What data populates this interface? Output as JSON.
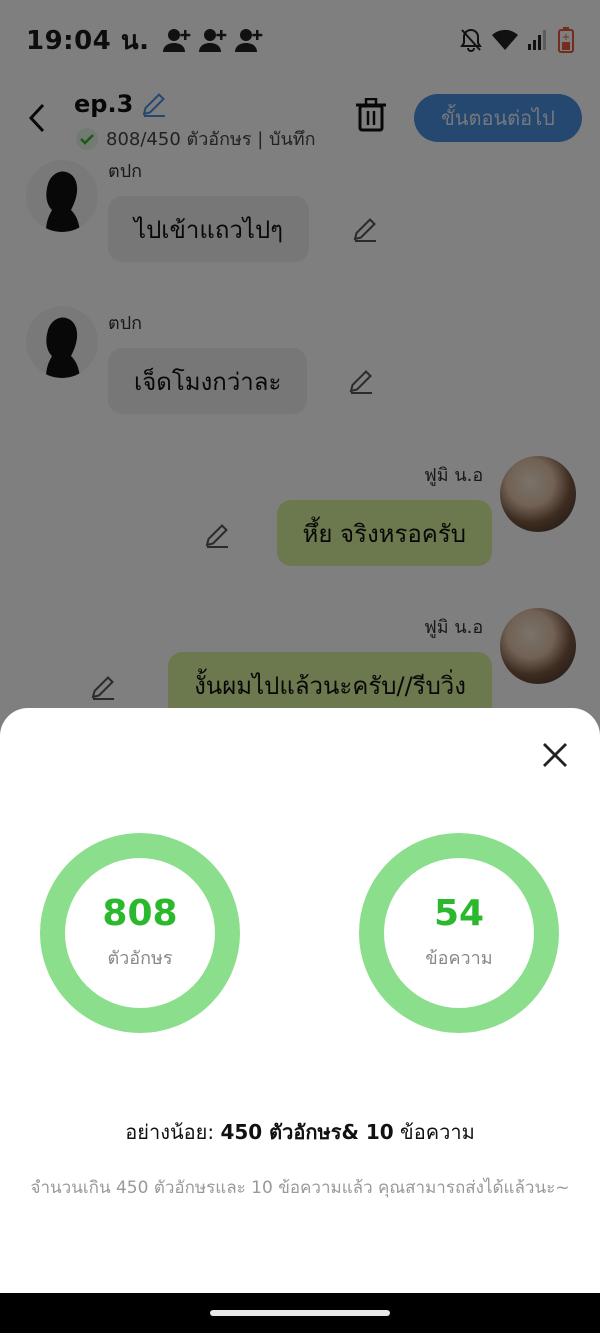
{
  "status": {
    "time": "19:04 น.",
    "icons": [
      "person-add-icon",
      "person-add-icon",
      "person-add-icon",
      "bell-off-icon",
      "wifi-icon",
      "signal-icon",
      "battery-icon"
    ]
  },
  "header": {
    "title": "ep.3",
    "subtitle": "808/450 ตัวอักษร | บันทึก",
    "next_label": "ขั้นตอนต่อไป"
  },
  "messages": [
    {
      "sender": "ตปก",
      "text": "ไปเข้าแถวไปๆ",
      "side": "left"
    },
    {
      "sender": "ตปก",
      "text": "เจ็ดโมงกว่าละ",
      "side": "left"
    },
    {
      "sender": "ฟูมิ น.อ",
      "text": "หึ้ย จริงหรอครับ",
      "side": "right"
    },
    {
      "sender": "ฟูมิ น.อ",
      "text": "งั้นผมไปแล้วนะครับ//รีบวิ่ง",
      "side": "right"
    }
  ],
  "stats": {
    "characters_value": "808",
    "characters_label": "ตัวอักษร",
    "messages_value": "54",
    "messages_label": "ข้อความ",
    "ring_color": "#8bde8b",
    "value_color": "#2cb82c"
  },
  "minimum": {
    "prefix": "อย่างน้อย:",
    "requirement": "450 ตัวอักษร& 10",
    "suffix": "ข้อความ"
  },
  "hint": "จำนวนเกิน 450 ตัวอักษรและ 10 ข้อความแล้ว คุณสามารถส่งได้แล้วนะ~"
}
